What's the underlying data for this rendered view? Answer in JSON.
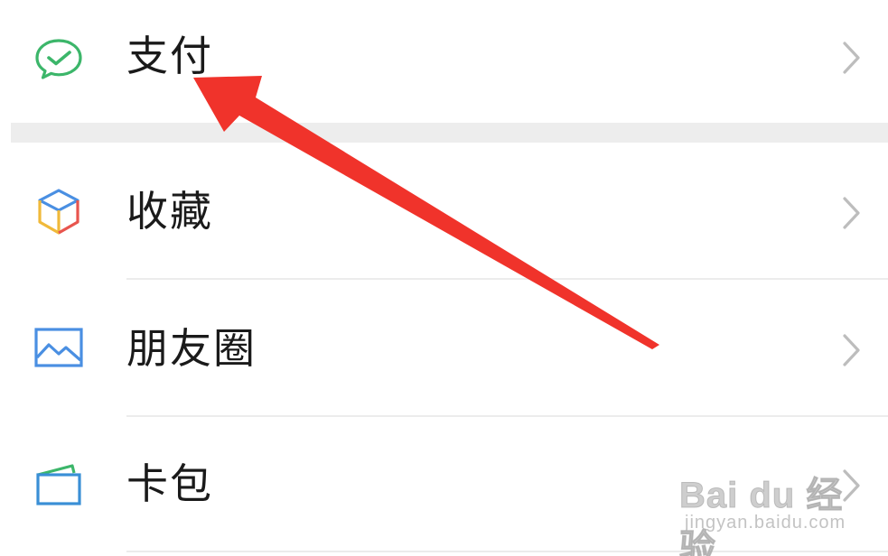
{
  "menu": {
    "items": [
      {
        "label": "支付",
        "icon": "wechat-pay-icon",
        "icon_color": "#3cb66a"
      },
      {
        "label": "收藏",
        "icon": "favorites-cube-icon",
        "icon_color": "#f0b93a"
      },
      {
        "label": "朋友圈",
        "icon": "moments-image-icon",
        "icon_color": "#4a8fe2"
      },
      {
        "label": "卡包",
        "icon": "card-wallet-icon",
        "icon_color": "#3a8fd6"
      }
    ]
  },
  "annotation": {
    "arrow_color": "#f0332b"
  },
  "watermark": {
    "brand": "Bai du 经验",
    "url": "jingyan.baidu.com"
  },
  "colors": {
    "background": "#ffffff",
    "section_gap": "#ededed",
    "chevron": "#bdbdbd"
  }
}
